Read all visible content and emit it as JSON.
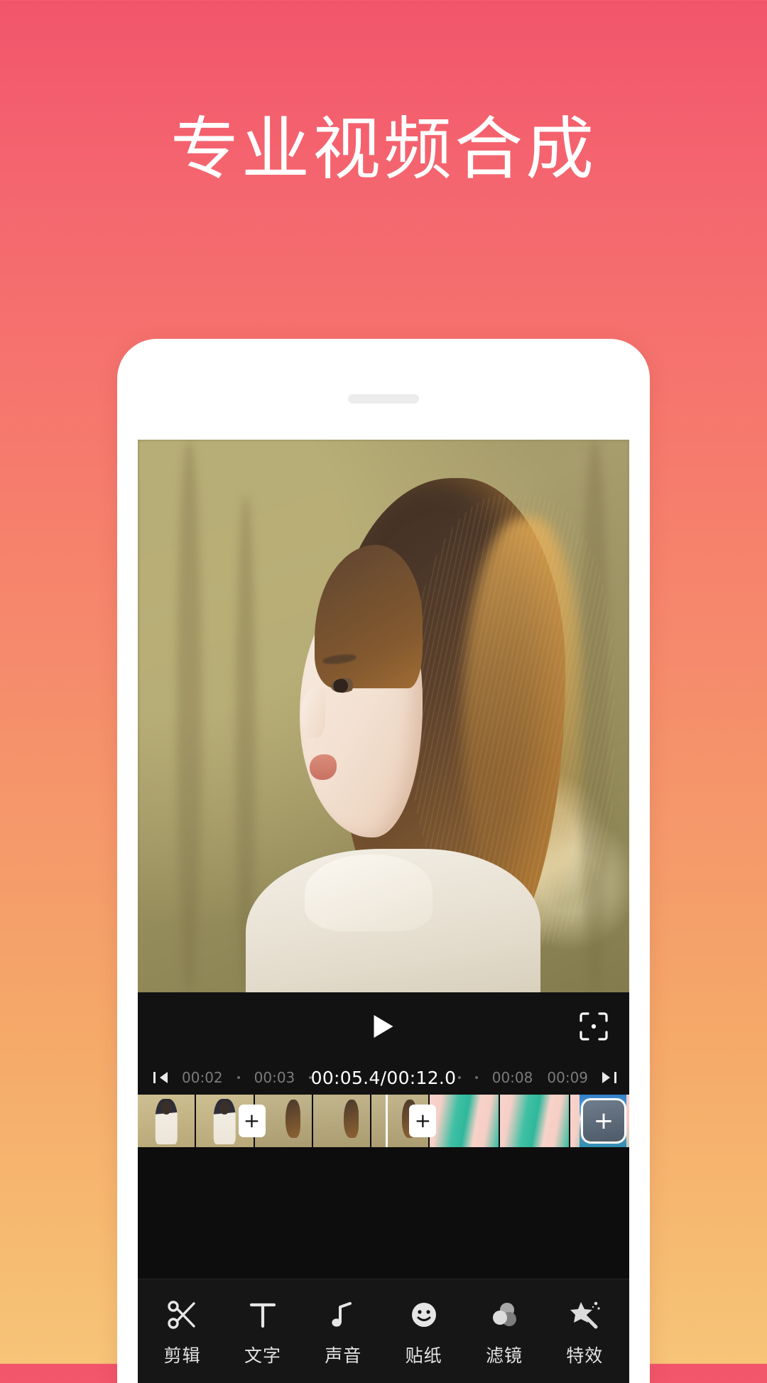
{
  "headline": "专业视频合成",
  "theme": {
    "gradient_top": "#f2556b",
    "gradient_bottom": "#f7c478",
    "phone_body": "#ffffff",
    "screen_bg": "#0d0d0d",
    "accent_white": "#ffffff"
  },
  "phone": {
    "speaker_label": "speaker-grille"
  },
  "player": {
    "play_label": "play",
    "crop_label": "crop",
    "current_time": "00:05.4",
    "separator": "/",
    "total_time": "00:12.0",
    "current_display": "00:05.4/00:12.0"
  },
  "ruler": {
    "prev_label": "skip-previous",
    "next_label": "skip-next",
    "left_marks": [
      "00:02",
      "00:03"
    ],
    "right_marks": [
      "00:08",
      "00:09"
    ]
  },
  "timeline": {
    "transition_plus": "+",
    "add_clip_plus": "+",
    "clips": [
      {
        "name": "clip-1",
        "kind": "person-indoor"
      },
      {
        "name": "clip-2",
        "kind": "person-indoor"
      },
      {
        "name": "clip-3",
        "kind": "portrait-field"
      },
      {
        "name": "clip-4",
        "kind": "portrait-field"
      },
      {
        "name": "clip-5",
        "kind": "portrait-field"
      },
      {
        "name": "clip-6",
        "kind": "pattern-teal"
      },
      {
        "name": "clip-7",
        "kind": "pattern-teal"
      },
      {
        "name": "clip-8",
        "kind": "pattern-teal"
      }
    ]
  },
  "toolbar": {
    "items": [
      {
        "label": "剪辑",
        "icon": "scissors-icon"
      },
      {
        "label": "文字",
        "icon": "text-t-icon"
      },
      {
        "label": "声音",
        "icon": "music-note-icon"
      },
      {
        "label": "贴纸",
        "icon": "smiley-icon"
      },
      {
        "label": "滤镜",
        "icon": "filter-circles-icon"
      },
      {
        "label": "特效",
        "icon": "magic-wand-star-icon"
      }
    ]
  }
}
